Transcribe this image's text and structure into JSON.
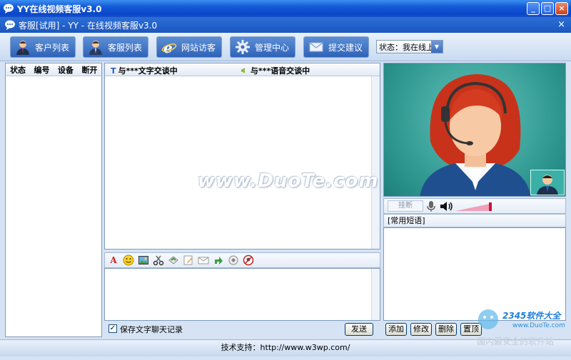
{
  "window": {
    "title": "YY在线视频客服v3.0",
    "minimize": "_",
    "maximize": "□",
    "close": "×"
  },
  "app": {
    "title": "客服[试用] - YY - 在线视频客服v3.0",
    "close": "×"
  },
  "toolbar": {
    "buttons": [
      {
        "label": "客户列表",
        "icon": "customer-icon"
      },
      {
        "label": "客服列表",
        "icon": "agent-icon"
      },
      {
        "label": "网站访客",
        "icon": "ie-icon"
      },
      {
        "label": "管理中心",
        "icon": "gear-icon"
      },
      {
        "label": "提交建议",
        "icon": "mail-icon"
      }
    ],
    "status_select": "状态：我在线上"
  },
  "client_list": {
    "columns": [
      "状态",
      "编号",
      "设备",
      "断开"
    ]
  },
  "chat": {
    "text_tab": "与***文字交谈中",
    "voice_tab": "与***语音交谈中",
    "text_tab_icon": "T",
    "watermark": "www.DuoTe.com",
    "save_history_label": "保存文字聊天记录",
    "save_history_checked": "✓",
    "send_label": "发送"
  },
  "video": {
    "hangup_label": "挂断"
  },
  "phrases": {
    "header": "[常用短语]",
    "buttons": [
      "添加",
      "修改",
      "删除",
      "置顶"
    ]
  },
  "footer": {
    "support": "技术支持：http://www.w3wp.com/"
  },
  "watermark_logo": {
    "brand": "2345软件大全",
    "url": "www.DuoTe.com",
    "slogan": "国内最安全的软件站"
  },
  "colors": {
    "accent_blue": "#2e62b8",
    "video_bg": "#2e968f"
  }
}
